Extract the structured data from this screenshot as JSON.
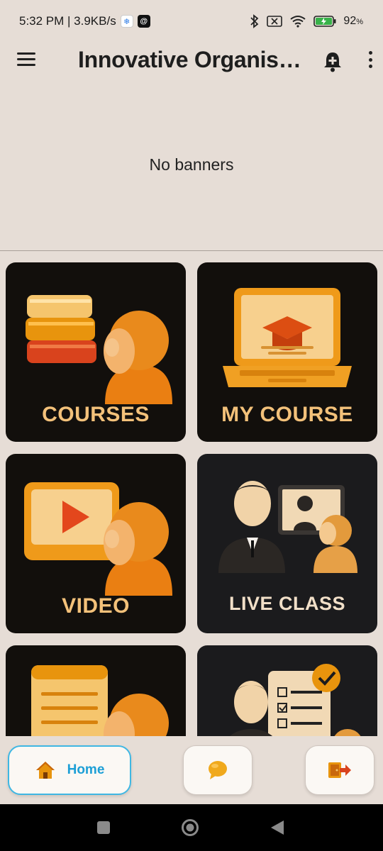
{
  "status_bar": {
    "time_speed": "5:32 PM | 3.9KB/s",
    "battery": "92"
  },
  "app_bar": {
    "title": "Innovative Organisa…"
  },
  "banner": {
    "text": "No banners"
  },
  "grid": {
    "cards": [
      {
        "label": "COURSES"
      },
      {
        "label": "MY COURSE"
      },
      {
        "label": "VIDEO"
      },
      {
        "label": "LIVE CLASS"
      }
    ]
  },
  "bottom_nav": {
    "home_label": "Home",
    "active_color": "#3fb7e3"
  },
  "icons": [
    "menu-icon",
    "notification-bell-icon",
    "more-vert-icon",
    "home-icon",
    "chat-icon",
    "logout-icon"
  ]
}
